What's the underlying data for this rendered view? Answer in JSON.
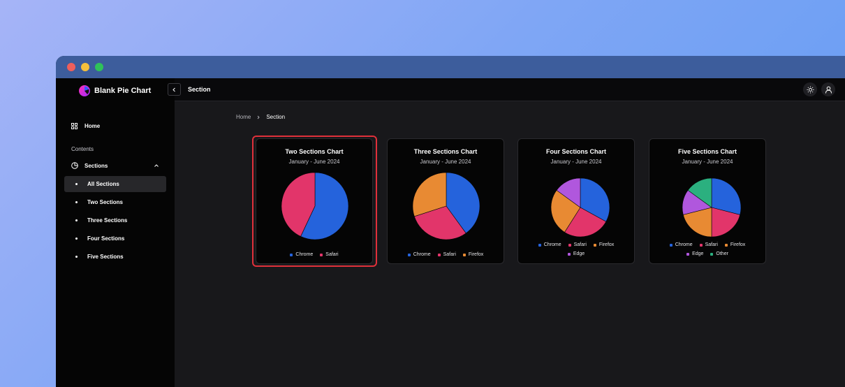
{
  "app": {
    "brand": "Blank Pie Chart",
    "page_title": "Section"
  },
  "sidebar": {
    "home_label": "Home",
    "contents_label": "Contents",
    "sections_label": "Sections",
    "items": [
      {
        "label": "All Sections",
        "active": true
      },
      {
        "label": "Two Sections",
        "active": false
      },
      {
        "label": "Three Sections",
        "active": false
      },
      {
        "label": "Four Sections",
        "active": false
      },
      {
        "label": "Five Sections",
        "active": false
      }
    ]
  },
  "breadcrumb": {
    "home": "Home",
    "current": "Section"
  },
  "colors": {
    "chrome": "#2563dc",
    "safari": "#e2356a",
    "firefox": "#e88a33",
    "edge": "#b057dd",
    "other": "#2bb07f"
  },
  "chart_data": [
    {
      "type": "pie",
      "title": "Two Sections Chart",
      "subtitle": "January - June 2024",
      "categories": [
        "Chrome",
        "Safari"
      ],
      "values": [
        57,
        43
      ],
      "colors": [
        "#2563dc",
        "#e2356a"
      ],
      "legend": "bottom"
    },
    {
      "type": "pie",
      "title": "Three Sections Chart",
      "subtitle": "January - June 2024",
      "categories": [
        "Chrome",
        "Safari",
        "Firefox"
      ],
      "values": [
        40,
        30,
        30
      ],
      "colors": [
        "#2563dc",
        "#e2356a",
        "#e88a33"
      ],
      "legend": "bottom"
    },
    {
      "type": "pie",
      "title": "Four Sections Chart",
      "subtitle": "January - June 2024",
      "categories": [
        "Chrome",
        "Safari",
        "Firefox",
        "Edge"
      ],
      "values": [
        33,
        26,
        26,
        15
      ],
      "colors": [
        "#2563dc",
        "#e2356a",
        "#e88a33",
        "#b057dd"
      ],
      "legend": "bottom"
    },
    {
      "type": "pie",
      "title": "Five Sections Chart",
      "subtitle": "January - June 2024",
      "categories": [
        "Chrome",
        "Safari",
        "Firefox",
        "Edge",
        "Other"
      ],
      "values": [
        29,
        21,
        21,
        14,
        15
      ],
      "colors": [
        "#2563dc",
        "#e2356a",
        "#e88a33",
        "#b057dd",
        "#2bb07f"
      ],
      "legend": "bottom"
    }
  ]
}
